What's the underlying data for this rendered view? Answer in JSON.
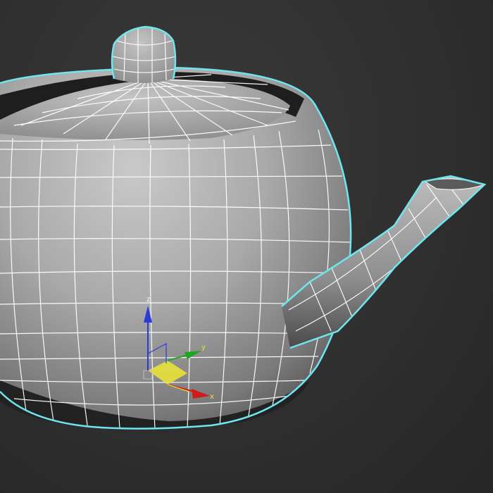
{
  "viewport": {
    "background": "#2e2e2e",
    "selection_outline_color": "#6fe6ef",
    "wireframe_color": "#ffffff"
  },
  "object": {
    "type": "teapot",
    "selected": true
  },
  "transform_gizmo": {
    "axes": [
      {
        "name": "z",
        "label": "z",
        "color": "#2b3bd8"
      },
      {
        "name": "y",
        "label": "y",
        "color": "#1fa51f"
      },
      {
        "name": "x",
        "label": "x",
        "color": "#d31a1a"
      }
    ],
    "plane_color": "#e8e23a"
  }
}
